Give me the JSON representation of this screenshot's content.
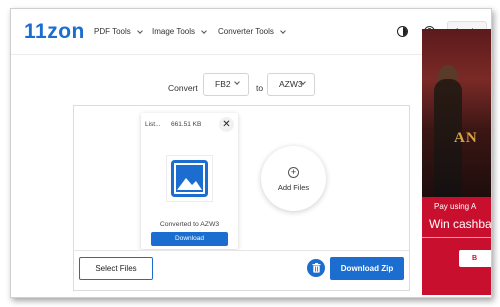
{
  "header": {
    "logo": "11zon",
    "nav": [
      {
        "label": "PDF Tools"
      },
      {
        "label": "Image Tools"
      },
      {
        "label": "Converter Tools"
      }
    ],
    "help_symbol": "?",
    "login_label": "Log in"
  },
  "converter": {
    "convert_label": "Convert",
    "from_format": "FB2",
    "to_label": "to",
    "to_format": "AZW3"
  },
  "file": {
    "name": "List...",
    "size": "661.51 KB",
    "close_symbol": "✕",
    "status": "Converted to AZW3",
    "download_label": "Download"
  },
  "add_files": {
    "plus_symbol": "+",
    "label": "Add Files"
  },
  "actions": {
    "select_files_label": "Select Files",
    "download_zip_label": "Download Zip"
  },
  "ad": {
    "title_fragment": "AN",
    "line1": "Pay using A",
    "line2": "Win cashba",
    "button_fragment": "B"
  },
  "colors": {
    "accent": "#1c6dd0",
    "ad_red": "#c8102e"
  },
  "icons": [
    "contrast-icon",
    "help-icon",
    "close-icon",
    "image-icon",
    "plus-icon",
    "trash-icon",
    "chevron-down-icon"
  ]
}
